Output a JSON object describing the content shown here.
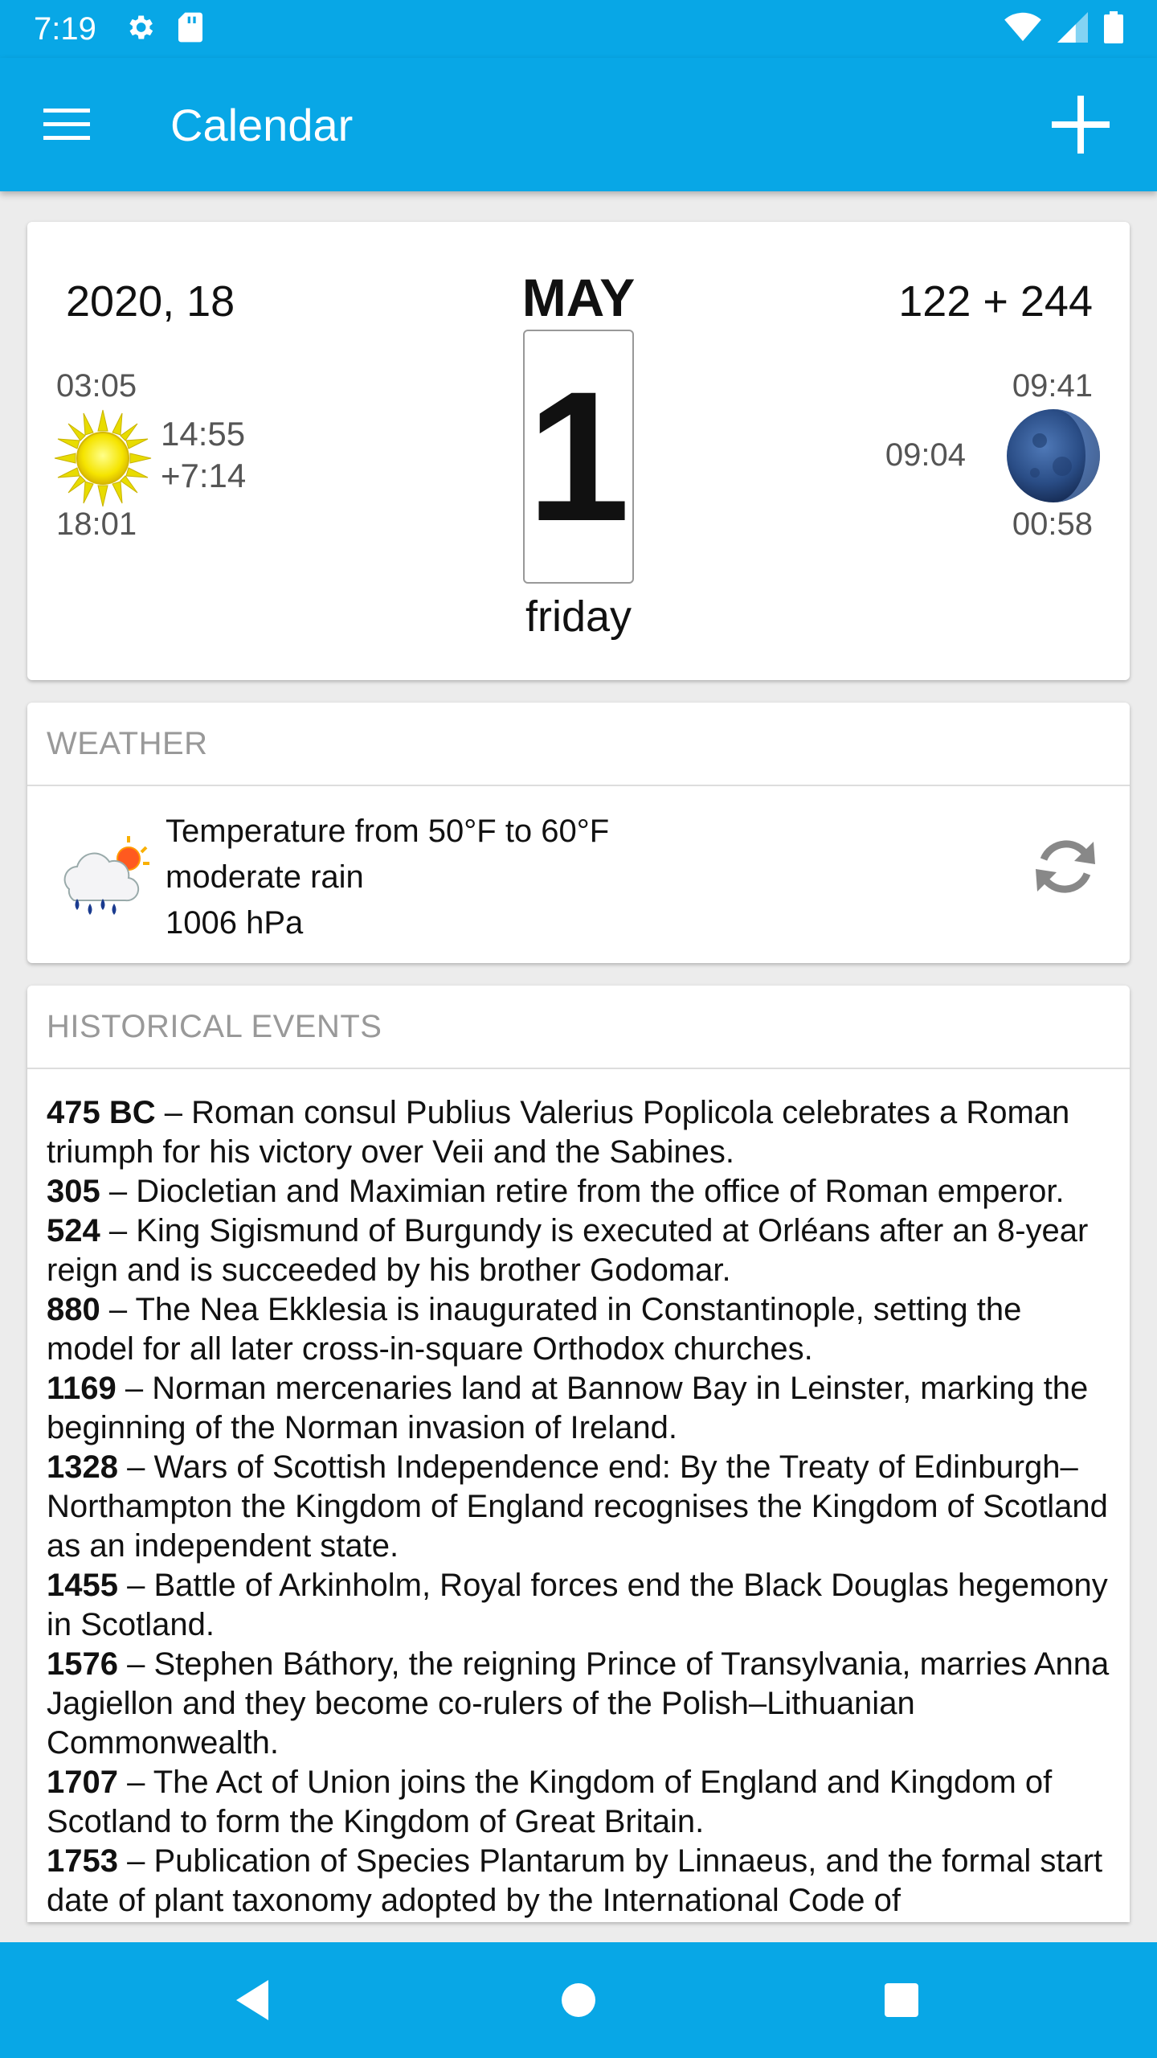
{
  "status_bar": {
    "time": "7:19",
    "icons": [
      "gear-icon",
      "sd-card-icon",
      "wifi-icon",
      "cell-signal-icon",
      "battery-icon"
    ]
  },
  "app_bar": {
    "title": "Calendar",
    "menu_icon": "hamburger-menu-icon",
    "add_icon": "plus-icon"
  },
  "date_card": {
    "year_week": "2020, 18",
    "month": "MAY",
    "day": "1",
    "weekday": "friday",
    "day_of_year": "122 + 244",
    "sun": {
      "rise": "03:05",
      "day_length": "14:55",
      "diff": "+7:14",
      "set": "18:01"
    },
    "moon": {
      "rise": "09:41",
      "time": "09:04",
      "set": "00:58"
    }
  },
  "weather": {
    "header": "WEATHER",
    "temperature": "Temperature from 50°F to 60°F",
    "condition": "moderate rain",
    "pressure": "1006 hPa",
    "icon": "rain-sun-cloud-icon",
    "refresh_icon": "refresh-icon"
  },
  "history": {
    "header": "HISTORICAL EVENTS",
    "events": [
      {
        "year": "475 BC",
        "text": " – Roman consul Publius Valerius Poplicola celebrates a Roman triumph for his victory over Veii and the Sabines."
      },
      {
        "year": "305",
        "text": " – Diocletian and Maximian retire from the office of Roman emperor."
      },
      {
        "year": "524",
        "text": " – King Sigismund of Burgundy is executed at Orléans after an 8-year reign and is succeeded by his brother Godomar."
      },
      {
        "year": "880",
        "text": " – The Nea Ekklesia is inaugurated in Constantinople, setting the model for all later cross-in-square Orthodox churches."
      },
      {
        "year": "1169",
        "text": " – Norman mercenaries land at Bannow Bay in Leinster, marking the beginning of the Norman invasion of Ireland."
      },
      {
        "year": "1328",
        "text": " – Wars of Scottish Independence end: By the Treaty of Edinburgh–Northampton the Kingdom of England recognises the Kingdom of Scotland as an independent state."
      },
      {
        "year": "1455",
        "text": " – Battle of Arkinholm, Royal forces end the Black Douglas hegemony in Scotland."
      },
      {
        "year": "1576",
        "text": " – Stephen Báthory, the reigning Prince of Transylvania, marries Anna Jagiellon and they become co-rulers of the Polish–Lithuanian Commonwealth."
      },
      {
        "year": "1707",
        "text": " – The Act of Union joins the Kingdom of England and Kingdom of Scotland to form the Kingdom of Great Britain."
      },
      {
        "year": "1753",
        "text": " – Publication of Species Plantarum by Linnaeus, and the formal start date of plant taxonomy adopted by the International Code of"
      }
    ]
  },
  "nav_bar": {
    "icons": [
      "back-icon",
      "home-icon",
      "recents-icon"
    ]
  },
  "colors": {
    "accent": "#08a7e6",
    "background": "#ececec"
  }
}
